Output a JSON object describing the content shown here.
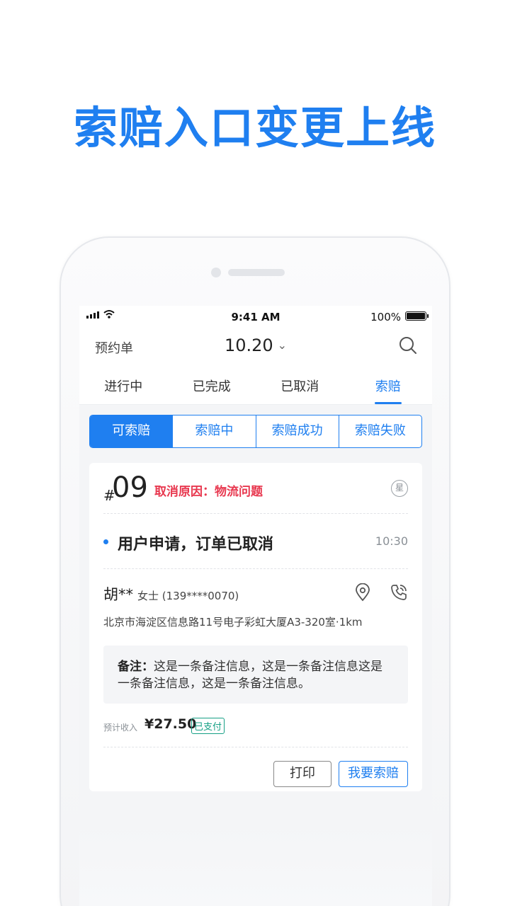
{
  "headline": "索赔入口变更上线",
  "status_bar": {
    "time": "9:41 AM",
    "battery": "100%"
  },
  "nav": {
    "title": "预约单",
    "date": "10.20",
    "chevron": "⌄"
  },
  "tabs": [
    "进行中",
    "已完成",
    "已取消",
    "索赔"
  ],
  "segments": [
    "可索赔",
    "索赔中",
    "索赔成功",
    "索赔失败"
  ],
  "order": {
    "hash": "#",
    "number": "09",
    "cancel_reason": "取消原因：物流问题",
    "star_badge": "星",
    "status_text": "用户申请，订单已取消",
    "status_time": "10:30",
    "customer_name": "胡**",
    "customer_sub": "女士 (139****0070)",
    "address": "北京市海淀区信息路11号电子彩虹大厦A3-320室·1km",
    "note_label": "备注：",
    "note_text": "这是一条备注信息，这是一条备注信息这是一条备注信息，这是一条备注信息。",
    "income_label": "预计收入",
    "income_amount": "¥27.50",
    "paid_badge": "已支付",
    "print_label": "打印",
    "claim_label": "我要索赔"
  },
  "colors": {
    "accent": "#1f7ff0",
    "danger": "#e8384f",
    "paid": "#16a085"
  }
}
